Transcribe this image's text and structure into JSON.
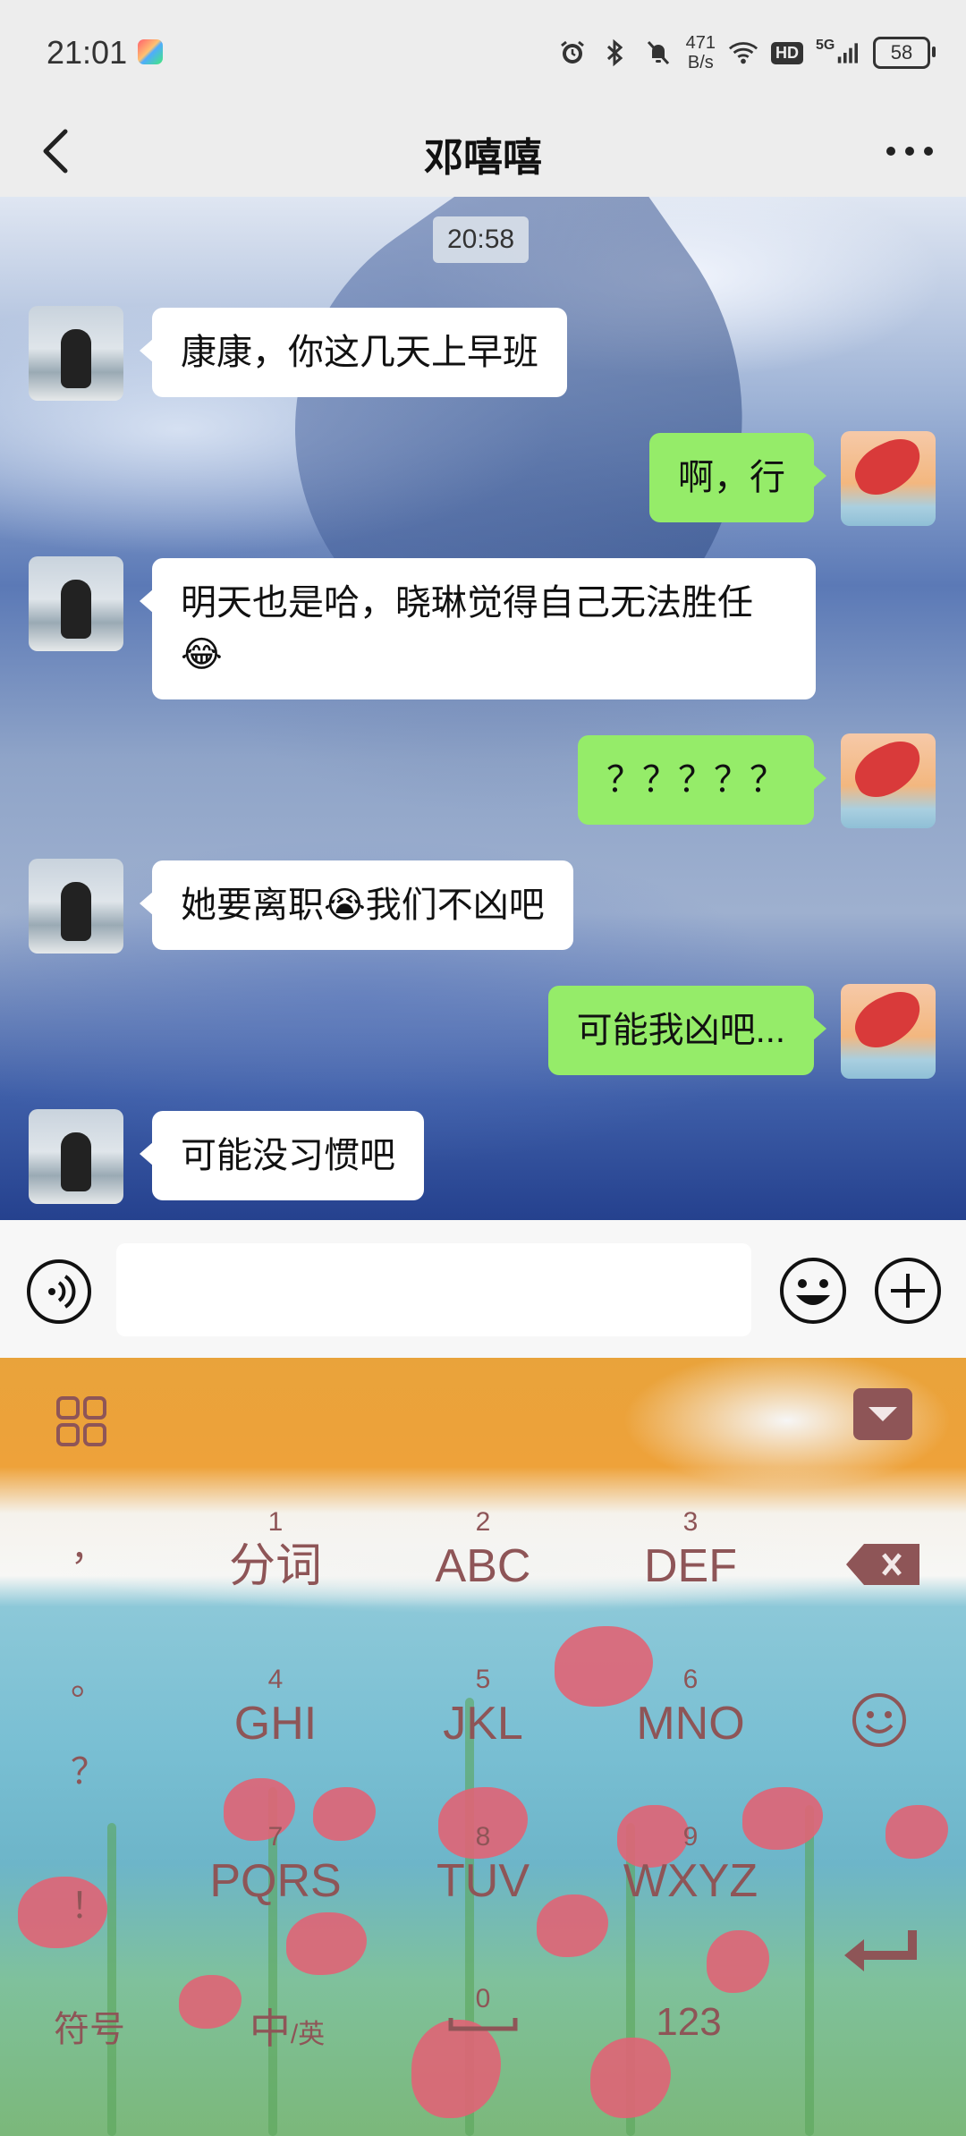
{
  "status_bar": {
    "time": "21:01",
    "network_speed_value": "471",
    "network_speed_unit": "B/s",
    "network_type": "5G",
    "hd_label": "HD",
    "battery": "58",
    "icons": [
      "alarm-icon",
      "bluetooth-icon",
      "mute-icon",
      "wifi-icon",
      "signal-icon"
    ]
  },
  "header": {
    "title": "邓嘻嘻",
    "back_icon": "chevron-left-icon",
    "more_icon": "more-horizontal-icon"
  },
  "chat": {
    "timestamp": "20:58",
    "messages": [
      {
        "sender": "other",
        "text": "康康，你这几天上早班"
      },
      {
        "sender": "me",
        "text": "啊，行"
      },
      {
        "sender": "other",
        "text": "明天也是哈，晓琳觉得自己无法胜任😂"
      },
      {
        "sender": "me",
        "text": "？？？？？"
      },
      {
        "sender": "other",
        "text": "她要离职😭我们不凶吧"
      },
      {
        "sender": "me",
        "text": "可能我凶吧..."
      },
      {
        "sender": "other",
        "text": "可能没习惯吧"
      }
    ]
  },
  "input_bar": {
    "voice_icon": "voice-icon",
    "value": "",
    "emoji_icon": "emoji-icon",
    "plus_icon": "plus-circle-icon"
  },
  "keyboard": {
    "menu_icon": "grid-icon",
    "collapse_icon": "collapse-keyboard-icon",
    "keys": [
      {
        "num": "1",
        "letters": "分词"
      },
      {
        "num": "2",
        "letters": "ABC"
      },
      {
        "num": "3",
        "letters": "DEF"
      },
      {
        "num": "4",
        "letters": "GHI"
      },
      {
        "num": "5",
        "letters": "JKL"
      },
      {
        "num": "6",
        "letters": "MNO"
      },
      {
        "num": "7",
        "letters": "PQRS"
      },
      {
        "num": "8",
        "letters": "TUV"
      },
      {
        "num": "9",
        "letters": "WXYZ"
      }
    ],
    "side_chars": [
      "，",
      "。",
      "？",
      "！"
    ],
    "symbol_key": "符号",
    "lang_key_main": "中",
    "lang_key_sub": "/英",
    "space_num": "0",
    "num_key": "123",
    "delete_icon": "backspace-icon",
    "smile_icon": "smiley-icon",
    "enter_icon": "enter-icon"
  }
}
